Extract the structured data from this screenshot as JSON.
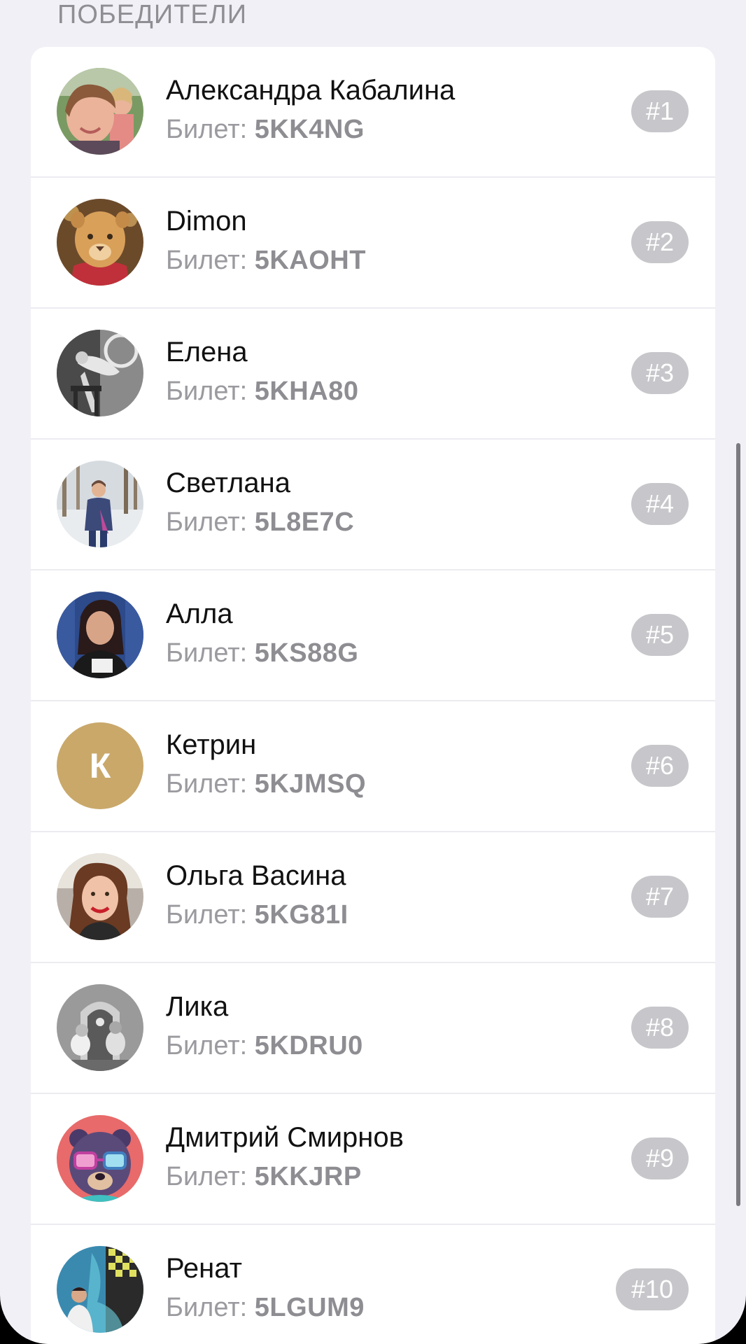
{
  "section_title": "ПОБЕДИТЕЛИ",
  "ticket_label": "Билет: ",
  "winners": [
    {
      "name": "Александра Кабалина",
      "ticket": "5KK4NG",
      "rank": "#1",
      "avatar": "photo-woman-child"
    },
    {
      "name": "Dimon",
      "ticket": "5KAOHT",
      "rank": "#2",
      "avatar": "photo-lion"
    },
    {
      "name": "Елена",
      "ticket": "5KHA80",
      "rank": "#3",
      "avatar": "photo-bw-figure"
    },
    {
      "name": "Светлана",
      "ticket": "5L8E7C",
      "rank": "#4",
      "avatar": "photo-woman-outdoors"
    },
    {
      "name": "Алла",
      "ticket": "5KS88G",
      "rank": "#5",
      "avatar": "photo-woman-portrait"
    },
    {
      "name": "Кетрин",
      "ticket": "5KJMSQ",
      "rank": "#6",
      "avatar_letter": "К",
      "avatar_color": "#c9a86a"
    },
    {
      "name": "Ольга Васина",
      "ticket": "5KG81I",
      "rank": "#7",
      "avatar": "photo-woman-smiling"
    },
    {
      "name": "Лика",
      "ticket": "5KDRU0",
      "rank": "#8",
      "avatar": "photo-bw-people"
    },
    {
      "name": "Дмитрий Смирнов",
      "ticket": "5KKJRP",
      "rank": "#9",
      "avatar": "illustration-bear-glasses"
    },
    {
      "name": "Ренат",
      "ticket": "5LGUM9",
      "rank": "#10",
      "avatar": "photo-man-mural"
    }
  ],
  "colors": {
    "background": "#f1f0f6",
    "card": "#ffffff",
    "badge": "#c7c7cb",
    "muted_text": "#9a9a9f"
  }
}
